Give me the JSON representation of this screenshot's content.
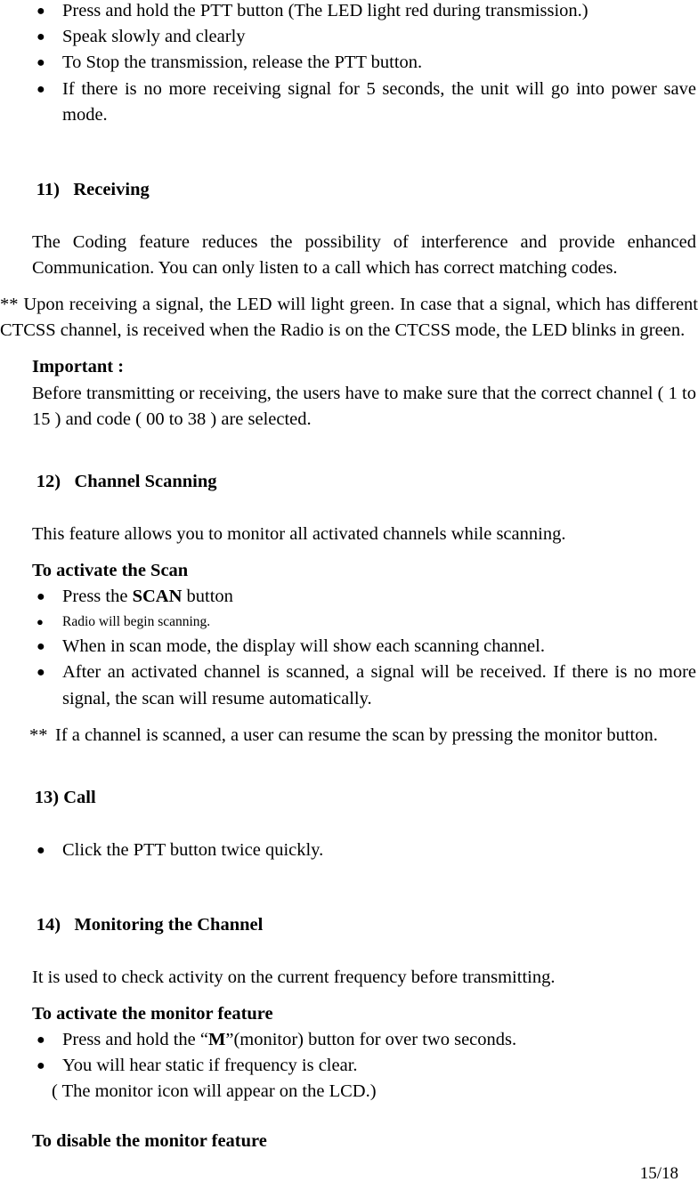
{
  "document": {
    "page_number": "15/18",
    "bullet_glyph": "●"
  },
  "intro_bullets": [
    "Press and hold the PTT button (The LED light red during transmission.)",
    "Speak slowly and clearly",
    "To Stop the transmission, release the PTT button.",
    "If there is no more receiving signal for 5 seconds, the unit will go into power save mode."
  ],
  "section_11": {
    "number": "11)",
    "title": "Receiving",
    "body": "The Coding feature reduces the possibility of interference and provide enhanced Communication. You can only listen to a call which has correct matching codes.",
    "note": "** Upon receiving a signal, the LED will light green. In case that a signal, which has different CTCSS channel, is received when the Radio is on the CTCSS mode, the LED blinks in green.",
    "important_label": "Important :",
    "important_body": "Before transmitting or receiving, the users have to make sure that the correct channel ( 1 to 15 ) and code ( 00 to 38 ) are selected."
  },
  "section_12": {
    "number": "12)",
    "title": "Channel Scanning",
    "body": "This feature allows you to monitor all activated channels while scanning.",
    "subhead": "To activate the Scan",
    "bullets": [
      {
        "text_before": "Press the ",
        "bold": "SCAN",
        "text_after": " button",
        "small": false
      },
      {
        "text_before": "Radio will begin scanning.",
        "bold": "",
        "text_after": "",
        "small": true
      },
      {
        "text_before": "When in scan mode, the display will show each scanning channel.",
        "bold": "",
        "text_after": "",
        "small": false
      },
      {
        "text_before": "After an activated channel is scanned, a signal will be received. If there is no more signal, the scan will resume automatically.",
        "bold": "",
        "text_after": "",
        "small": false
      }
    ],
    "note_stars": "**",
    "note_text": "If a channel is scanned, a user can resume the scan by pressing the monitor button."
  },
  "section_13": {
    "number": "13)",
    "title": "Call",
    "bullets": [
      "Click the PTT button twice quickly."
    ]
  },
  "section_14": {
    "number": "14)",
    "title": "Monitoring the Channel",
    "body": "It is used to check activity on the current frequency before transmitting.",
    "subhead_activate": "To activate the monitor feature",
    "bullet_1_before": "Press and hold the “",
    "bullet_1_bold": "M",
    "bullet_1_after": "”(monitor) button for over two seconds.",
    "bullet_2": "You will hear static if frequency is clear.",
    "lcd_note": "( The monitor icon will appear on the LCD.)",
    "subhead_disable": "To disable the monitor feature"
  }
}
